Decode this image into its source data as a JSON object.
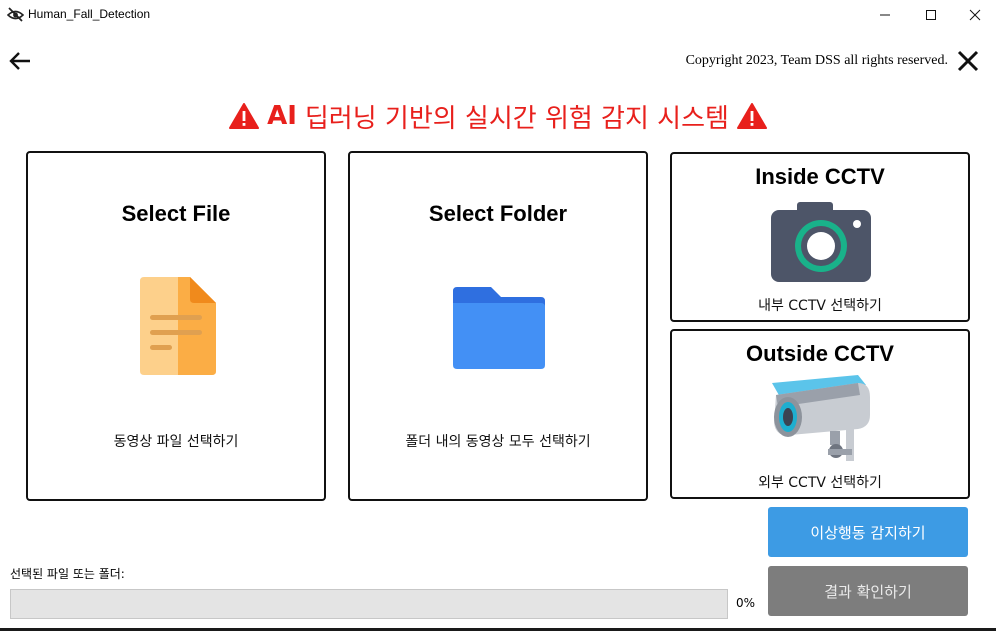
{
  "window": {
    "title": "Human_Fall_Detection",
    "controls": [
      "minimize-icon",
      "maximize-icon",
      "close-icon"
    ]
  },
  "header": {
    "back_icon": "arrow-left-icon",
    "copyright": "Copyright 2023, Team DSS all rights reserved.",
    "close_icon": "close-x-icon"
  },
  "main_title": {
    "ai": "AI",
    "text": "딥러닝 기반의 실시간 위험 감지 시스템",
    "icon": "warning-icon",
    "color": "#e8201c"
  },
  "cards": {
    "file": {
      "title": "Select File",
      "subtitle": "동영상 파일 선택하기",
      "icon": "document-icon"
    },
    "folder": {
      "title": "Select Folder",
      "subtitle": "폴더 내의 동영상 모두 선택하기",
      "icon": "folder-icon"
    },
    "inside": {
      "title": "Inside CCTV",
      "subtitle": "내부 CCTV 선택하기",
      "icon": "camera-icon"
    },
    "outside": {
      "title": "Outside CCTV",
      "subtitle": "외부 CCTV 선택하기",
      "icon": "cctv-icon"
    }
  },
  "actions": {
    "detect_label": "이상행동 감지하기",
    "result_label": "결과 확인하기",
    "detect_color": "#3d9be4",
    "result_color": "#7d7d7d"
  },
  "progress": {
    "label": "선택된 파일 또는 폴더:",
    "value": 0,
    "percent_text": "0%"
  }
}
